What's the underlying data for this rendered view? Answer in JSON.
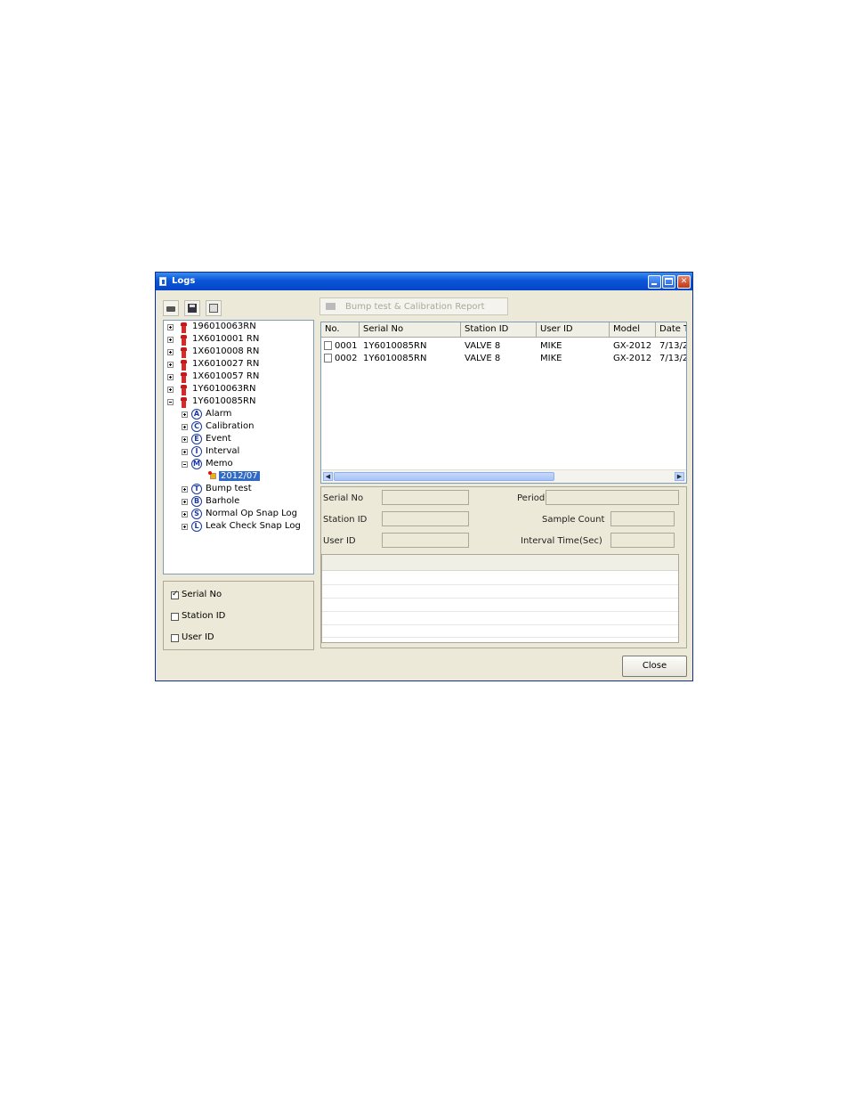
{
  "window": {
    "title": "Logs"
  },
  "toolbar": {
    "print_icon": "printer-icon",
    "save_icon": "floppy-disk-icon",
    "clipboard_icon": "clipboard-icon"
  },
  "report_button": {
    "label": "Bump test & Calibration Report",
    "icon": "printer-icon",
    "enabled": false
  },
  "tree": {
    "devices": [
      "196010063RN",
      "1X6010001 RN",
      "1X6010008 RN",
      "1X6010027 RN",
      "1X6010057 RN",
      "1Y6010063RN",
      "1Y6010085RN"
    ],
    "children": [
      {
        "letter": "A",
        "label": "Alarm"
      },
      {
        "letter": "C",
        "label": "Calibration"
      },
      {
        "letter": "E",
        "label": "Event"
      },
      {
        "letter": "I",
        "label": "Interval"
      },
      {
        "letter": "M",
        "label": "Memo"
      },
      {
        "letter": "T",
        "label": "Bump test"
      },
      {
        "letter": "B",
        "label": "Barhole"
      },
      {
        "letter": "S",
        "label": "Normal Op Snap Log"
      },
      {
        "letter": "L",
        "label": "Leak Check Snap Log"
      }
    ],
    "memo_item": "2012/07"
  },
  "filters": [
    {
      "label": "Serial No",
      "checked": true
    },
    {
      "label": "Station ID",
      "checked": false
    },
    {
      "label": "User ID",
      "checked": false
    }
  ],
  "table": {
    "headers": [
      "No.",
      "Serial No",
      "Station ID",
      "User ID",
      "Model",
      "Date T"
    ],
    "rows": [
      [
        "0001",
        "1Y6010085RN",
        "VALVE 8",
        "MIKE",
        "GX-2012",
        "7/13/2"
      ],
      [
        "0002",
        "1Y6010085RN",
        "VALVE 8",
        "MIKE",
        "GX-2012",
        "7/13/2"
      ]
    ]
  },
  "details": {
    "serial_label": "Serial No",
    "station_label": "Station ID",
    "user_label": "User ID",
    "period_label": "Period",
    "sample_label": "Sample Count",
    "interval_label": "Interval Time(Sec)"
  },
  "close_button": {
    "label": "Close"
  }
}
